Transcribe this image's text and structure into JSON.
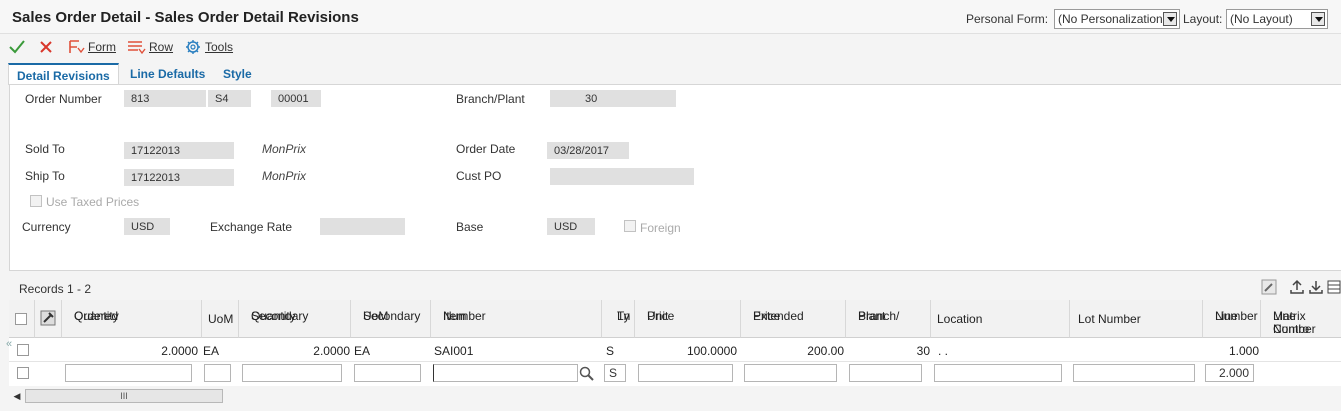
{
  "window": {
    "title": "Sales Order Detail - Sales Order Detail Revisions",
    "personal_form_label": "Personal Form:",
    "personal_form_value": "(No Personalization)",
    "layout_label": "Layout:",
    "layout_value": "(No Layout)"
  },
  "toolbar": {
    "ok_icon": "checkmark-icon",
    "cancel_icon": "x-icon",
    "form_label": "Form",
    "row_label": "Row",
    "tools_label": "Tools"
  },
  "tabs": [
    {
      "label": "Detail Revisions",
      "active": true
    },
    {
      "label": "Line Defaults",
      "active": false
    },
    {
      "label": "Style",
      "active": false
    }
  ],
  "form": {
    "order_number_label": "Order Number",
    "order_number": "813",
    "order_type": "S4",
    "order_company": "00001",
    "branch_plant_label": "Branch/Plant",
    "branch_plant": "30",
    "sold_to_label": "Sold To",
    "sold_to": "17122013",
    "sold_to_name": "MonPrix",
    "order_date_label": "Order Date",
    "order_date": "03/28/2017",
    "ship_to_label": "Ship To",
    "ship_to": "17122013",
    "ship_to_name": "MonPrix",
    "cust_po_label": "Cust PO",
    "cust_po": "",
    "use_taxed_prices_label": "Use Taxed Prices",
    "currency_label": "Currency",
    "currency": "USD",
    "exchange_rate_label": "Exchange Rate",
    "exchange_rate": "",
    "base_label": "Base",
    "base": "USD",
    "foreign_label": "Foreign"
  },
  "grid": {
    "records_label": "Records 1 - 2",
    "columns": [
      {
        "line1": "Quantity",
        "line2": "Ordered"
      },
      {
        "line1": "UoM",
        "line2": ""
      },
      {
        "line1": "Secondary",
        "line2": "Quantity"
      },
      {
        "line1": "Secondary",
        "line2": "UoM"
      },
      {
        "line1": "Item",
        "line2": "Number"
      },
      {
        "line1": "Ln",
        "line2": "Ty"
      },
      {
        "line1": "Unit",
        "line2": "Price"
      },
      {
        "line1": "Extended",
        "line2": "Price"
      },
      {
        "line1": "Branch/",
        "line2": "Plant"
      },
      {
        "line1": "Location",
        "line2": ""
      },
      {
        "line1": "Lot Number",
        "line2": ""
      },
      {
        "line1": "Line",
        "line2": "Number"
      },
      {
        "line1": "Matrix Contro",
        "line2": "Line Number"
      }
    ],
    "rows": [
      {
        "quantity_ordered": "2.0000",
        "uom": "EA",
        "secondary_quantity": "2.0000",
        "secondary_uom": "EA",
        "item_number": "SAI001",
        "ln_ty": "S",
        "unit_price": "100.0000",
        "extended_price": "200.00",
        "branch_plant": "30",
        "location": ". .",
        "lot_number": "",
        "line_number": "1.000",
        "matrix_control_line_number": ""
      }
    ],
    "new_row": {
      "ln_ty": "S",
      "line_number": "2.000"
    },
    "scrollbar_glyph": "III"
  }
}
